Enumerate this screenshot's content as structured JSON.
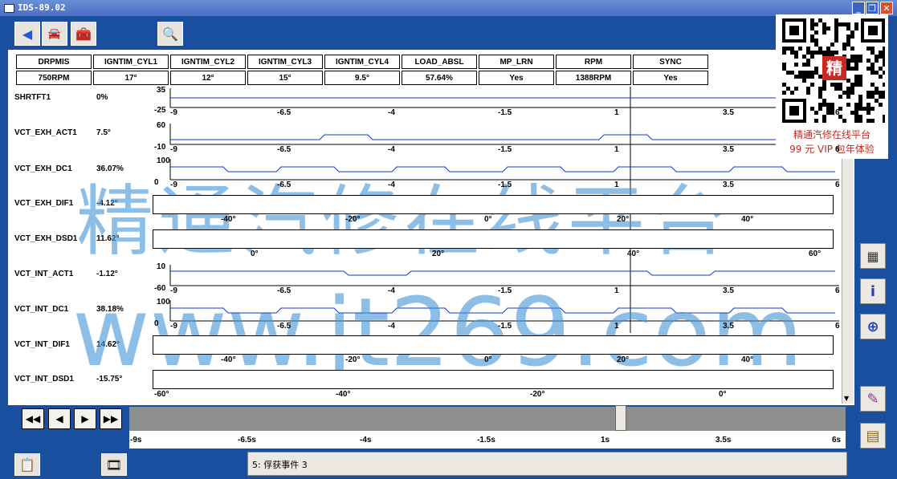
{
  "window": {
    "title": "IDS-89.02",
    "min": "_",
    "max": "❐",
    "close": "✕"
  },
  "toolbar": {
    "icons": [
      "back-arrow-icon",
      "vehicle-icon",
      "toolbox-icon",
      "datalogger-icon"
    ]
  },
  "pids": {
    "headers": [
      "DRPMIS",
      "IGNTIM_CYL1",
      "IGNTIM_CYL2",
      "IGNTIM_CYL3",
      "IGNTIM_CYL4",
      "LOAD_ABSL",
      "MP_LRN",
      "RPM",
      "SYNC"
    ],
    "values": [
      "750RPM",
      "17°",
      "12°",
      "15°",
      "9.5°",
      "57.64%",
      "Yes",
      "1388RPM",
      "Yes"
    ]
  },
  "rows": [
    {
      "label": "SHRTFT1",
      "value": "0%",
      "ymax": "35",
      "ymin": "-25"
    },
    {
      "label": "VCT_EXH_ACT1",
      "value": "7.5°",
      "ymax": "60",
      "ymin": "-10"
    },
    {
      "label": "VCT_EXH_DC1",
      "value": "36.07%",
      "ymax": "100",
      "ymin": "0"
    },
    {
      "label": "VCT_EXH_DIF1",
      "value": "-4.12°"
    },
    {
      "label": "VCT_EXH_DSD1",
      "value": "11.62°"
    },
    {
      "label": "VCT_INT_ACT1",
      "value": "-1.12°",
      "ymax": "10",
      "ymin": "-60"
    },
    {
      "label": "VCT_INT_DC1",
      "value": "38.18%",
      "ymax": "100",
      "ymin": "0"
    },
    {
      "label": "VCT_INT_DIF1",
      "value": "14.62°"
    },
    {
      "label": "VCT_INT_DSD1",
      "value": "-15.75°"
    }
  ],
  "graph_x_ticks": [
    "-9",
    "-6.5",
    "-4",
    "-1.5",
    "1",
    "3.5",
    "6"
  ],
  "dif_ticks": [
    "-40°",
    "-20°",
    "0°",
    "20°",
    "40°"
  ],
  "exh_dsd_ticks": [
    "0°",
    "20°",
    "40°",
    "60°"
  ],
  "int_dsd_ticks": [
    "-60°",
    "-40°",
    "-20°",
    "0°"
  ],
  "playback": {
    "first": "◀◀",
    "prev": "◀",
    "next": "▶",
    "last": "▶▶"
  },
  "time_ticks": [
    "-9s",
    "-6.5s",
    "-4s",
    "-1.5s",
    "1s",
    "3.5s",
    "6s"
  ],
  "status": "5: 俘获事件 3",
  "ad": {
    "line1": "精通汽修在线平台",
    "line2": "99 元 VIP 包年体验",
    "qr_badge": "精"
  },
  "watermark": {
    "line1": "精通汽修在线平台",
    "line2": "www.jt269.com"
  },
  "right_buttons": [
    "select-icon",
    "info-icon",
    "zoom-icon",
    "eraser-icon",
    "files-icon"
  ]
}
